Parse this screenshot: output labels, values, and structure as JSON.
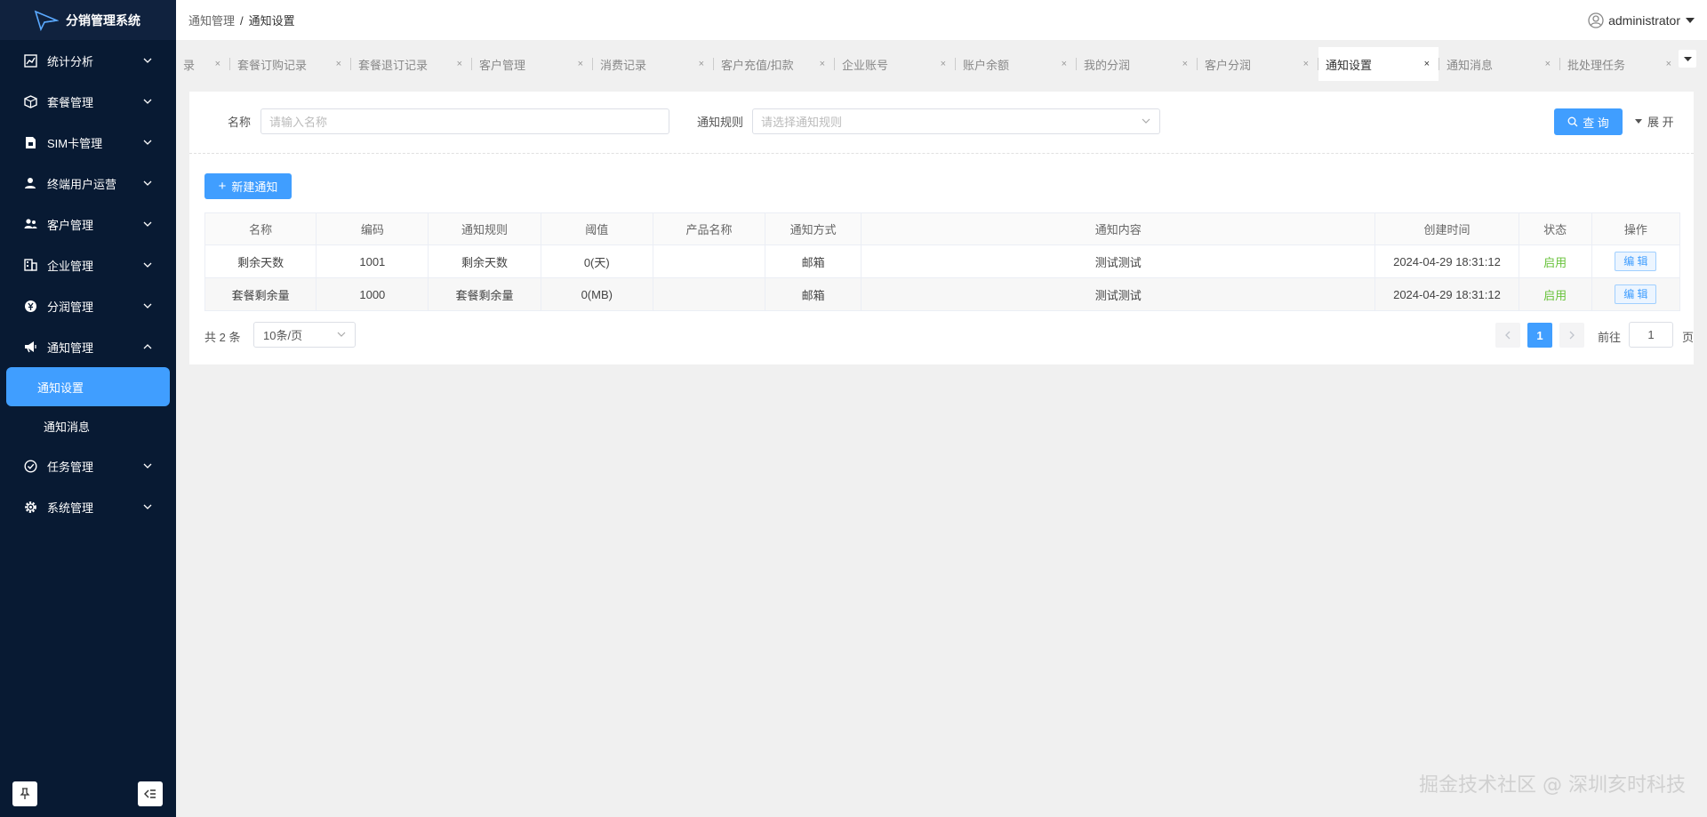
{
  "sidebar": {
    "logo_text": "分销管理系统",
    "menus": [
      {
        "label": "统计分析",
        "icon": "chart-icon"
      },
      {
        "label": "套餐管理",
        "icon": "package-icon"
      },
      {
        "label": "SIM卡管理",
        "icon": "sim-card-icon"
      },
      {
        "label": "终端用户运营",
        "icon": "user-icon"
      },
      {
        "label": "客户管理",
        "icon": "customers-icon"
      },
      {
        "label": "企业管理",
        "icon": "building-icon"
      },
      {
        "label": "分润管理",
        "icon": "yen-icon"
      },
      {
        "label": "通知管理",
        "icon": "megaphone-icon"
      }
    ],
    "notify_sub": [
      "通知设置",
      "通知消息"
    ],
    "menus_after": [
      {
        "label": "任务管理",
        "icon": "check-circle-icon"
      },
      {
        "label": "系统管理",
        "icon": "gear-icon"
      }
    ]
  },
  "header": {
    "breadcrumb": [
      "通知管理",
      "通知设置"
    ],
    "breadcrumb_sep": "/",
    "username": "administrator"
  },
  "tabs": [
    "录",
    "套餐订购记录",
    "套餐退订记录",
    "客户管理",
    "消费记录",
    "客户充值/扣款",
    "企业账号",
    "账户余额",
    "我的分润",
    "客户分润",
    "通知设置",
    "通知消息",
    "批处理任务"
  ],
  "tab_close": "×",
  "filter": {
    "name_label": "名称",
    "name_placeholder": "请输入名称",
    "rule_label": "通知规则",
    "rule_placeholder": "请选择通知规则",
    "query_label": "查 询",
    "expand_label": "展 开"
  },
  "new_button": "新建通知",
  "table": {
    "headers": [
      "名称",
      "编码",
      "通知规则",
      "阈值",
      "产品名称",
      "通知方式",
      "通知内容",
      "创建时间",
      "状态",
      "操作"
    ],
    "rows": [
      [
        "剩余天数",
        "1001",
        "剩余天数",
        "0(天)",
        "",
        "邮箱",
        "测试测试",
        "2024-04-29 18:31:12",
        "启用",
        "编 辑"
      ],
      [
        "套餐剩余量",
        "1000",
        "套餐剩余量",
        "0(MB)",
        "",
        "邮箱",
        "测试测试",
        "2024-04-29 18:31:12",
        "启用",
        "编 辑"
      ]
    ]
  },
  "pagination": {
    "total": "共 2 条",
    "page_size": "10条/页",
    "current_page": "1",
    "goto_label": "前往",
    "goto_value": "1",
    "goto_unit": "页"
  },
  "watermark": "掘金技术社区 @ 深圳亥时科技",
  "colors": {
    "sidebar_bg": "#081a33",
    "accent": "#409eff",
    "status_on": "#67c23a"
  }
}
